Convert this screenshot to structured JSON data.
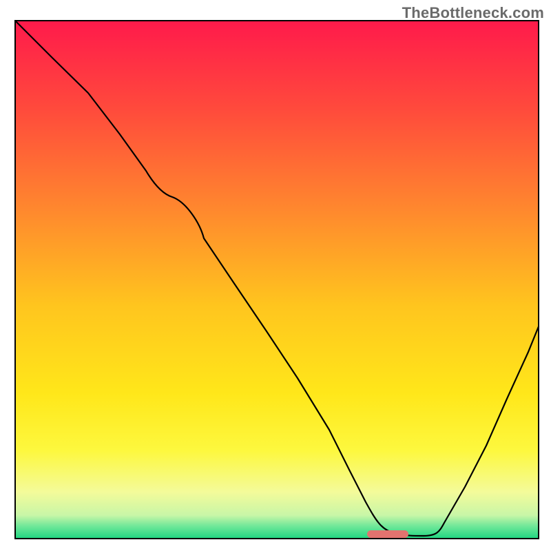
{
  "watermark": {
    "text": "TheBottleneck.com"
  },
  "chart_data": {
    "type": "line",
    "title": "",
    "xlabel": "",
    "ylabel": "",
    "xlim": [
      0,
      100
    ],
    "ylim": [
      0,
      100
    ],
    "grid": false,
    "legend": false,
    "background": {
      "type": "vertical-gradient",
      "stops": [
        {
          "pos": 0.0,
          "color": "#ff1a4b"
        },
        {
          "pos": 0.17,
          "color": "#ff4a3c"
        },
        {
          "pos": 0.35,
          "color": "#ff832f"
        },
        {
          "pos": 0.55,
          "color": "#ffc51e"
        },
        {
          "pos": 0.72,
          "color": "#ffe71a"
        },
        {
          "pos": 0.83,
          "color": "#fdf83e"
        },
        {
          "pos": 0.91,
          "color": "#f4fb9a"
        },
        {
          "pos": 0.955,
          "color": "#c8f6a7"
        },
        {
          "pos": 0.975,
          "color": "#73e89a"
        },
        {
          "pos": 1.0,
          "color": "#1fd681"
        }
      ]
    },
    "series": [
      {
        "name": "bottleneck-curve",
        "color": "#000000",
        "x": [
          0,
          7,
          14,
          20,
          25,
          30,
          36,
          42,
          48,
          54,
          60,
          64,
          67,
          70,
          74,
          78,
          82,
          86,
          90,
          94,
          98,
          100
        ],
        "y": [
          100,
          93,
          86,
          78,
          71,
          66,
          58,
          49,
          40,
          31,
          21,
          13,
          7,
          3,
          1,
          0,
          3,
          10,
          18,
          27,
          36,
          41
        ]
      }
    ],
    "marker": {
      "name": "optimal-point",
      "shape": "rounded-bar",
      "x": 70.5,
      "y": 0.6,
      "width": 6.5,
      "height": 1.3,
      "color": "#e2736f"
    }
  }
}
